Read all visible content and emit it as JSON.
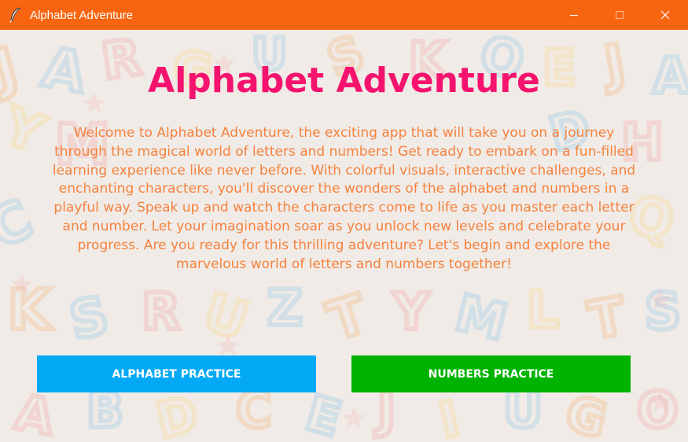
{
  "window": {
    "title": "Alphabet Adventure",
    "controls": {
      "minimize_icon": "minimize-icon",
      "maximize_icon": "maximize-icon",
      "close_icon": "close-icon"
    }
  },
  "main": {
    "heading": "Alphabet Adventure",
    "intro": "Welcome to Alphabet Adventure, the exciting app that will take you on a journey through the magical world of letters and numbers! Get ready to embark on a fun-filled learning experience like never before. With colorful visuals, interactive challenges, and enchanting characters, you'll discover the wonders of the alphabet and numbers in a playful way. Speak up and watch the characters come to life as you master each letter and number. Let your imagination soar as you unlock new levels and celebrate your progress. Are you ready for this thrilling adventure? Let's begin and explore the marvelous world of letters and numbers together!"
  },
  "buttons": {
    "alphabet_label": "ALPHABET PRACTICE",
    "numbers_label": "NUMBERS PRACTICE"
  },
  "colors": {
    "titlebar": "#f86511",
    "heading": "#f5136e",
    "intro_text": "#f5823e",
    "alphabet_button": "#03a9f4",
    "numbers_button": "#00b300",
    "background": "#f0ebe7"
  }
}
